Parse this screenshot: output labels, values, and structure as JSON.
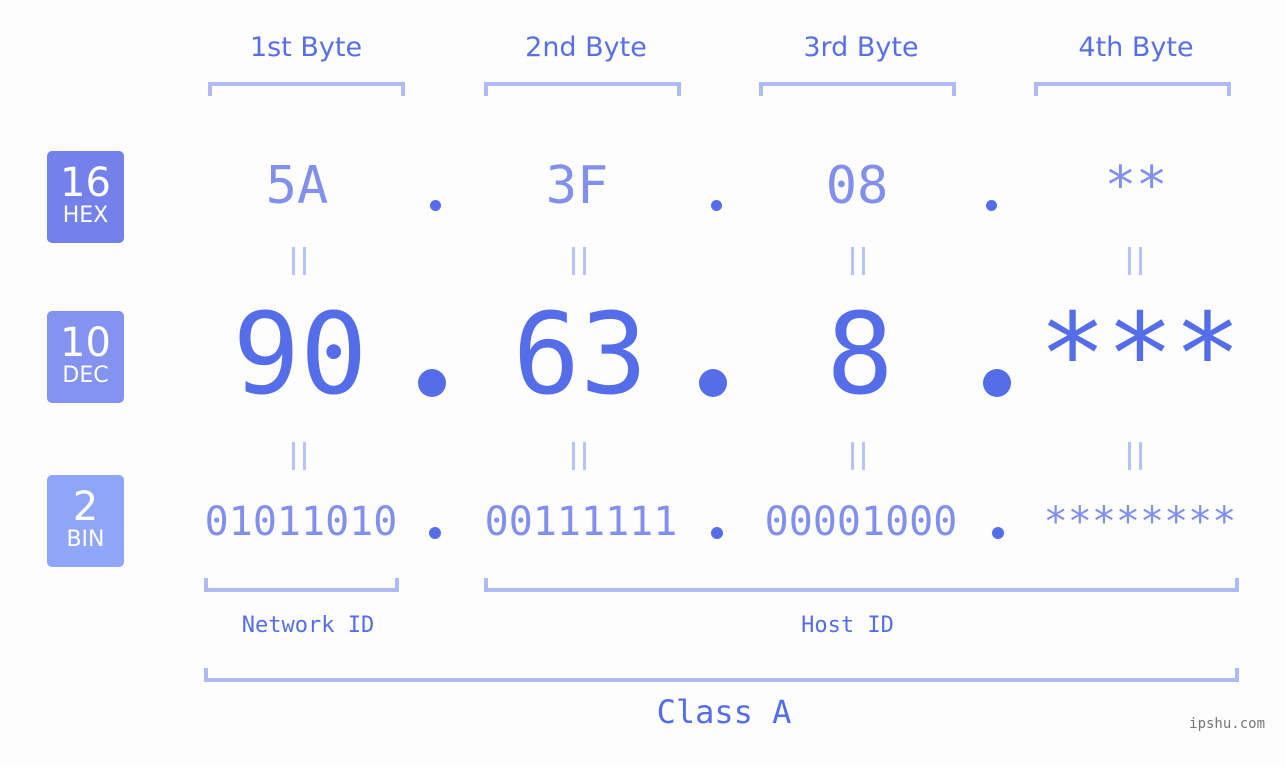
{
  "byte_headers": [
    "1st Byte",
    "2nd Byte",
    "3rd Byte",
    "4th Byte"
  ],
  "bases": [
    {
      "number": "16",
      "name": "HEX",
      "color": "#7481ea"
    },
    {
      "number": "10",
      "name": "DEC",
      "color": "#8593f0"
    },
    {
      "number": "2",
      "name": "BIN",
      "color": "#8fa5f7"
    }
  ],
  "hex_values": [
    "5A",
    "3F",
    "08",
    "**"
  ],
  "dec_values": [
    "90",
    "63",
    "8",
    "***"
  ],
  "bin_values": [
    "01011010",
    "00111111",
    "00001000",
    "********"
  ],
  "equals_symbol": "=",
  "segments": {
    "network_id": "Network ID",
    "host_id": "Host ID",
    "class_label": "Class A"
  },
  "watermark": "ipshu.com",
  "colors": {
    "primary": "#566de9",
    "light": "#8290ec",
    "bracket": "#b0baf5",
    "background": "#fcfdfc"
  }
}
